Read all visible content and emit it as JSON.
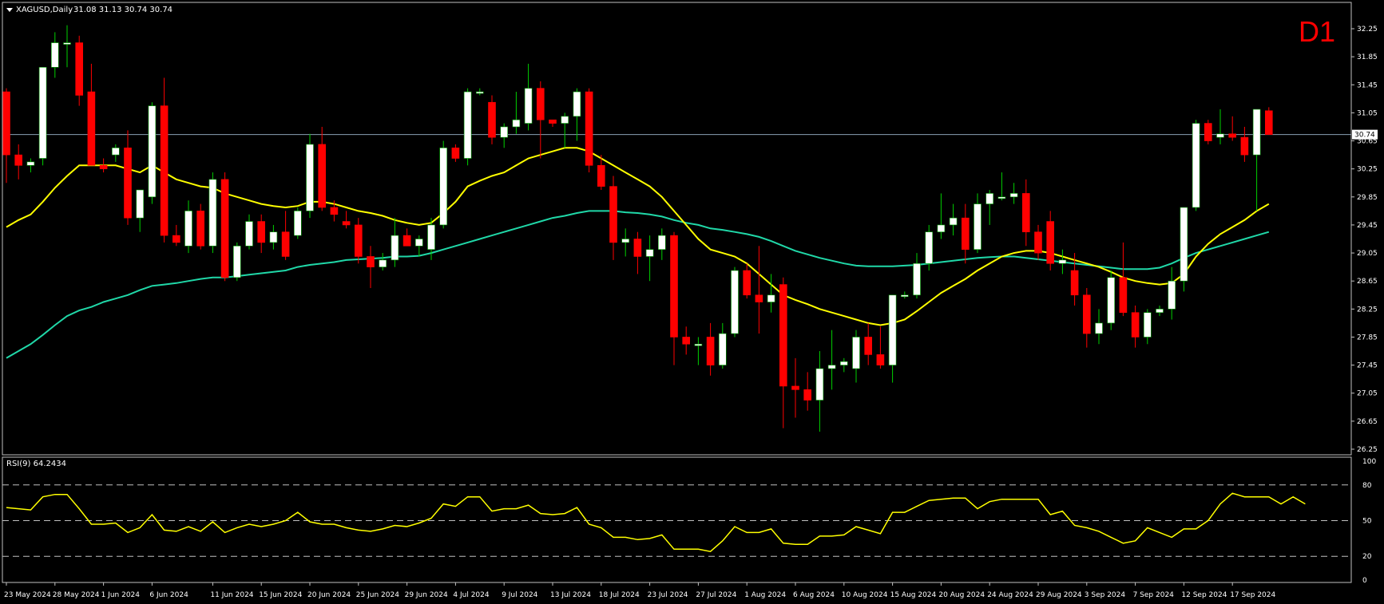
{
  "header": {
    "symbol_label": "XAGUSD,Daily",
    "ohlc_label": "31.08 31.13 30.74 30.74",
    "timeframe": "D1"
  },
  "rsi_panel": {
    "label": "RSI(9) 64.2434",
    "ticks": [
      "100",
      "80",
      "50",
      "20",
      "0"
    ]
  },
  "colors": {
    "background": "#000000",
    "bull_candle": "#ffffff",
    "bear_candle": "#ff0000",
    "ma_fast": "#ffff00",
    "ma_slow": "#20d8a8",
    "rsi_line": "#ffff00",
    "timeframe_text": "#ff0000",
    "grid_frame": "#c0c0c0"
  },
  "chart_data": [
    {
      "type": "candlestick",
      "symbol": "XAGUSD",
      "timeframe": "Daily",
      "ylim": [
        26.25,
        32.45
      ],
      "yticks": [
        "32.25",
        "31.85",
        "31.45",
        "31.05",
        "30.65",
        "30.25",
        "29.85",
        "29.45",
        "29.05",
        "28.65",
        "28.25",
        "27.85",
        "27.45",
        "27.05",
        "26.65",
        "26.25"
      ],
      "current_price": "30.74",
      "xticks": [
        {
          "label": "23 May 2024",
          "index": 0
        },
        {
          "label": "28 May 2024",
          "index": 4
        },
        {
          "label": "1 Jun 2024",
          "index": 8
        },
        {
          "label": "6 Jun 2024",
          "index": 12
        },
        {
          "label": "11 Jun 2024",
          "index": 17
        },
        {
          "label": "15 Jun 2024",
          "index": 21
        },
        {
          "label": "20 Jun 2024",
          "index": 25
        },
        {
          "label": "25 Jun 2024",
          "index": 29
        },
        {
          "label": "29 Jun 2024",
          "index": 33
        },
        {
          "label": "4 Jul 2024",
          "index": 37
        },
        {
          "label": "9 Jul 2024",
          "index": 41
        },
        {
          "label": "13 Jul 2024",
          "index": 45
        },
        {
          "label": "18 Jul 2024",
          "index": 49
        },
        {
          "label": "23 Jul 2024",
          "index": 53
        },
        {
          "label": "27 Jul 2024",
          "index": 57
        },
        {
          "label": "1 Aug 2024",
          "index": 61
        },
        {
          "label": "6 Aug 2024",
          "index": 65
        },
        {
          "label": "10 Aug 2024",
          "index": 69
        },
        {
          "label": "15 Aug 2024",
          "index": 73
        },
        {
          "label": "20 Aug 2024",
          "index": 77
        },
        {
          "label": "24 Aug 2024",
          "index": 81
        },
        {
          "label": "29 Aug 2024",
          "index": 85
        },
        {
          "label": "3 Sep 2024",
          "index": 89
        },
        {
          "label": "7 Sep 2024",
          "index": 93
        },
        {
          "label": "12 Sep 2024",
          "index": 97
        },
        {
          "label": "17 Sep 2024",
          "index": 101
        }
      ],
      "candles": [
        {
          "o": 31.35,
          "h": 31.4,
          "l": 30.05,
          "c": 30.45
        },
        {
          "o": 30.45,
          "h": 30.6,
          "l": 30.1,
          "c": 30.3
        },
        {
          "o": 30.3,
          "h": 30.4,
          "l": 30.2,
          "c": 30.35
        },
        {
          "o": 30.4,
          "h": 31.4,
          "l": 30.3,
          "c": 31.7
        },
        {
          "o": 31.7,
          "h": 32.2,
          "l": 31.55,
          "c": 32.05
        },
        {
          "o": 32.05,
          "h": 32.3,
          "l": 31.7,
          "c": 32.05
        },
        {
          "o": 32.05,
          "h": 32.15,
          "l": 31.15,
          "c": 31.3
        },
        {
          "o": 31.35,
          "h": 31.75,
          "l": 30.45,
          "c": 30.3
        },
        {
          "o": 30.3,
          "h": 30.4,
          "l": 30.2,
          "c": 30.25
        },
        {
          "o": 30.45,
          "h": 30.6,
          "l": 30.35,
          "c": 30.55
        },
        {
          "o": 30.55,
          "h": 30.8,
          "l": 29.45,
          "c": 29.55
        },
        {
          "o": 29.55,
          "h": 29.95,
          "l": 29.35,
          "c": 29.95
        },
        {
          "o": 29.85,
          "h": 31.2,
          "l": 29.75,
          "c": 31.15
        },
        {
          "o": 31.15,
          "h": 31.55,
          "l": 29.2,
          "c": 29.3
        },
        {
          "o": 29.3,
          "h": 29.45,
          "l": 29.15,
          "c": 29.2
        },
        {
          "o": 29.15,
          "h": 29.8,
          "l": 29.05,
          "c": 29.65
        },
        {
          "o": 29.65,
          "h": 29.75,
          "l": 29.1,
          "c": 29.15
        },
        {
          "o": 29.15,
          "h": 30.2,
          "l": 29.05,
          "c": 30.1
        },
        {
          "o": 30.1,
          "h": 30.2,
          "l": 28.65,
          "c": 28.7
        },
        {
          "o": 28.7,
          "h": 29.2,
          "l": 28.65,
          "c": 29.15
        },
        {
          "o": 29.15,
          "h": 29.6,
          "l": 29.1,
          "c": 29.5
        },
        {
          "o": 29.5,
          "h": 29.6,
          "l": 29.05,
          "c": 29.2
        },
        {
          "o": 29.2,
          "h": 29.45,
          "l": 29.1,
          "c": 29.35
        },
        {
          "o": 29.35,
          "h": 29.65,
          "l": 28.95,
          "c": 29.0
        },
        {
          "o": 29.3,
          "h": 29.7,
          "l": 29.25,
          "c": 29.65
        },
        {
          "o": 29.65,
          "h": 30.75,
          "l": 29.55,
          "c": 30.6
        },
        {
          "o": 30.6,
          "h": 30.85,
          "l": 29.65,
          "c": 29.7
        },
        {
          "o": 29.7,
          "h": 29.8,
          "l": 29.5,
          "c": 29.6
        },
        {
          "o": 29.5,
          "h": 29.65,
          "l": 29.4,
          "c": 29.45
        },
        {
          "o": 29.45,
          "h": 29.55,
          "l": 28.9,
          "c": 29.0
        },
        {
          "o": 29.0,
          "h": 29.15,
          "l": 28.55,
          "c": 28.85
        },
        {
          "o": 28.85,
          "h": 29.05,
          "l": 28.8,
          "c": 28.95
        },
        {
          "o": 28.95,
          "h": 29.55,
          "l": 28.85,
          "c": 29.3
        },
        {
          "o": 29.3,
          "h": 29.4,
          "l": 29.15,
          "c": 29.15
        },
        {
          "o": 29.15,
          "h": 29.3,
          "l": 29.0,
          "c": 29.25
        },
        {
          "o": 29.1,
          "h": 29.55,
          "l": 28.95,
          "c": 29.45
        },
        {
          "o": 29.45,
          "h": 30.65,
          "l": 29.4,
          "c": 30.55
        },
        {
          "o": 30.55,
          "h": 30.6,
          "l": 30.35,
          "c": 30.4
        },
        {
          "o": 30.4,
          "h": 31.4,
          "l": 30.3,
          "c": 31.35
        },
        {
          "o": 31.35,
          "h": 31.4,
          "l": 31.3,
          "c": 31.35
        },
        {
          "o": 31.2,
          "h": 31.3,
          "l": 30.6,
          "c": 30.7
        },
        {
          "o": 30.7,
          "h": 30.9,
          "l": 30.55,
          "c": 30.85
        },
        {
          "o": 30.85,
          "h": 31.35,
          "l": 30.75,
          "c": 30.95
        },
        {
          "o": 30.9,
          "h": 31.75,
          "l": 30.8,
          "c": 31.4
        },
        {
          "o": 31.4,
          "h": 31.5,
          "l": 30.4,
          "c": 30.95
        },
        {
          "o": 30.95,
          "h": 30.95,
          "l": 30.85,
          "c": 30.9
        },
        {
          "o": 30.9,
          "h": 31.05,
          "l": 30.55,
          "c": 31.0
        },
        {
          "o": 31.0,
          "h": 31.4,
          "l": 30.65,
          "c": 31.35
        },
        {
          "o": 31.35,
          "h": 31.4,
          "l": 30.2,
          "c": 30.3
        },
        {
          "o": 30.3,
          "h": 30.45,
          "l": 29.95,
          "c": 30.0
        },
        {
          "o": 30.0,
          "h": 30.15,
          "l": 28.95,
          "c": 29.2
        },
        {
          "o": 29.2,
          "h": 29.4,
          "l": 29.0,
          "c": 29.25
        },
        {
          "o": 29.25,
          "h": 29.35,
          "l": 28.75,
          "c": 29.0
        },
        {
          "o": 29.0,
          "h": 29.3,
          "l": 28.65,
          "c": 29.1
        },
        {
          "o": 29.1,
          "h": 29.4,
          "l": 28.95,
          "c": 29.3
        },
        {
          "o": 29.3,
          "h": 29.35,
          "l": 27.45,
          "c": 27.85
        },
        {
          "o": 27.85,
          "h": 28.0,
          "l": 27.6,
          "c": 27.75
        },
        {
          "o": 27.75,
          "h": 27.85,
          "l": 27.45,
          "c": 27.75
        },
        {
          "o": 27.85,
          "h": 28.05,
          "l": 27.3,
          "c": 27.45
        },
        {
          "o": 27.45,
          "h": 28.05,
          "l": 27.4,
          "c": 27.9
        },
        {
          "o": 27.9,
          "h": 28.85,
          "l": 27.85,
          "c": 28.8
        },
        {
          "o": 28.8,
          "h": 28.9,
          "l": 28.4,
          "c": 28.45
        },
        {
          "o": 28.45,
          "h": 29.15,
          "l": 27.9,
          "c": 28.35
        },
        {
          "o": 28.35,
          "h": 28.75,
          "l": 28.2,
          "c": 28.45
        },
        {
          "o": 28.6,
          "h": 28.7,
          "l": 26.55,
          "c": 27.15
        },
        {
          "o": 27.15,
          "h": 27.55,
          "l": 26.7,
          "c": 27.1
        },
        {
          "o": 27.1,
          "h": 27.35,
          "l": 26.8,
          "c": 26.95
        },
        {
          "o": 26.95,
          "h": 27.65,
          "l": 26.5,
          "c": 27.4
        },
        {
          "o": 27.4,
          "h": 27.95,
          "l": 27.1,
          "c": 27.45
        },
        {
          "o": 27.45,
          "h": 27.55,
          "l": 27.35,
          "c": 27.5
        },
        {
          "o": 27.4,
          "h": 27.95,
          "l": 27.2,
          "c": 27.85
        },
        {
          "o": 27.85,
          "h": 28.05,
          "l": 27.45,
          "c": 27.6
        },
        {
          "o": 27.6,
          "h": 28.0,
          "l": 27.4,
          "c": 27.45
        },
        {
          "o": 27.45,
          "h": 28.45,
          "l": 27.2,
          "c": 28.45
        },
        {
          "o": 28.45,
          "h": 28.5,
          "l": 28.4,
          "c": 28.45
        },
        {
          "o": 28.45,
          "h": 29.05,
          "l": 28.4,
          "c": 28.9
        },
        {
          "o": 28.9,
          "h": 29.45,
          "l": 28.8,
          "c": 29.35
        },
        {
          "o": 29.35,
          "h": 29.9,
          "l": 29.25,
          "c": 29.45
        },
        {
          "o": 29.45,
          "h": 29.75,
          "l": 29.3,
          "c": 29.55
        },
        {
          "o": 29.55,
          "h": 29.75,
          "l": 28.9,
          "c": 29.1
        },
        {
          "o": 29.1,
          "h": 29.9,
          "l": 29.05,
          "c": 29.75
        },
        {
          "o": 29.75,
          "h": 29.95,
          "l": 29.45,
          "c": 29.9
        },
        {
          "o": 29.85,
          "h": 30.2,
          "l": 29.8,
          "c": 29.85
        },
        {
          "o": 29.85,
          "h": 30.05,
          "l": 29.75,
          "c": 29.9
        },
        {
          "o": 29.9,
          "h": 30.1,
          "l": 29.15,
          "c": 29.35
        },
        {
          "o": 29.35,
          "h": 29.45,
          "l": 28.95,
          "c": 29.05
        },
        {
          "o": 29.5,
          "h": 29.65,
          "l": 28.8,
          "c": 28.9
        },
        {
          "o": 28.9,
          "h": 29.1,
          "l": 28.75,
          "c": 28.95
        },
        {
          "o": 28.8,
          "h": 29.05,
          "l": 28.3,
          "c": 28.45
        },
        {
          "o": 28.45,
          "h": 28.55,
          "l": 27.7,
          "c": 27.9
        },
        {
          "o": 27.9,
          "h": 28.25,
          "l": 27.75,
          "c": 28.05
        },
        {
          "o": 28.05,
          "h": 28.8,
          "l": 27.95,
          "c": 28.7
        },
        {
          "o": 28.7,
          "h": 29.2,
          "l": 28.15,
          "c": 28.2
        },
        {
          "o": 28.2,
          "h": 28.3,
          "l": 27.7,
          "c": 27.85
        },
        {
          "o": 27.85,
          "h": 28.25,
          "l": 27.75,
          "c": 28.2
        },
        {
          "o": 28.2,
          "h": 28.3,
          "l": 28.15,
          "c": 28.25
        },
        {
          "o": 28.25,
          "h": 28.85,
          "l": 28.1,
          "c": 28.65
        },
        {
          "o": 28.65,
          "h": 29.7,
          "l": 28.5,
          "c": 29.7
        },
        {
          "o": 29.7,
          "h": 30.95,
          "l": 29.65,
          "c": 30.9
        },
        {
          "o": 30.9,
          "h": 30.95,
          "l": 30.6,
          "c": 30.65
        },
        {
          "o": 30.7,
          "h": 31.1,
          "l": 30.6,
          "c": 30.75
        },
        {
          "o": 30.75,
          "h": 31.0,
          "l": 30.65,
          "c": 30.7
        },
        {
          "o": 30.7,
          "h": 30.85,
          "l": 30.35,
          "c": 30.45
        },
        {
          "o": 30.45,
          "h": 30.95,
          "l": 29.65,
          "c": 31.1
        },
        {
          "o": 31.08,
          "h": 31.13,
          "l": 30.74,
          "c": 30.74
        }
      ],
      "ma_fast": [
        29.42,
        29.52,
        29.6,
        29.78,
        29.98,
        30.15,
        30.3,
        30.3,
        30.3,
        30.3,
        30.25,
        30.2,
        30.3,
        30.2,
        30.1,
        30.05,
        30.0,
        29.98,
        29.9,
        29.85,
        29.8,
        29.75,
        29.72,
        29.7,
        29.72,
        29.78,
        29.78,
        29.75,
        29.7,
        29.65,
        29.62,
        29.58,
        29.52,
        29.48,
        29.45,
        29.48,
        29.62,
        29.78,
        30.0,
        30.08,
        30.15,
        30.2,
        30.3,
        30.4,
        30.45,
        30.5,
        30.55,
        30.55,
        30.5,
        30.4,
        30.3,
        30.2,
        30.1,
        30.0,
        29.85,
        29.65,
        29.45,
        29.25,
        29.1,
        29.05,
        29.0,
        28.9,
        28.75,
        28.6,
        28.45,
        28.38,
        28.32,
        28.25,
        28.2,
        28.15,
        28.1,
        28.05,
        28.02,
        28.05,
        28.1,
        28.22,
        28.35,
        28.48,
        28.58,
        28.68,
        28.8,
        28.9,
        29.0,
        29.05,
        29.08,
        29.08,
        29.05,
        29.0,
        28.95,
        28.9,
        28.85,
        28.78,
        28.7,
        28.65,
        28.62,
        28.6,
        28.62,
        28.75,
        29.0,
        29.18,
        29.32,
        29.42,
        29.52,
        29.65,
        29.75
      ],
      "ma_slow": [
        27.55,
        27.65,
        27.75,
        27.88,
        28.02,
        28.15,
        28.23,
        28.28,
        28.35,
        28.4,
        28.45,
        28.52,
        28.58,
        28.6,
        28.62,
        28.65,
        28.68,
        28.7,
        28.7,
        28.72,
        28.74,
        28.76,
        28.78,
        28.8,
        28.85,
        28.88,
        28.9,
        28.92,
        28.95,
        28.96,
        28.97,
        28.98,
        29.0,
        29.0,
        29.01,
        29.05,
        29.1,
        29.15,
        29.2,
        29.25,
        29.3,
        29.35,
        29.4,
        29.45,
        29.5,
        29.55,
        29.58,
        29.62,
        29.65,
        29.65,
        29.65,
        29.63,
        29.62,
        29.6,
        29.57,
        29.52,
        29.48,
        29.45,
        29.4,
        29.38,
        29.35,
        29.32,
        29.28,
        29.22,
        29.15,
        29.08,
        29.03,
        28.98,
        28.94,
        28.9,
        28.87,
        28.86,
        28.86,
        28.86,
        28.87,
        28.88,
        28.9,
        28.92,
        28.94,
        28.96,
        28.98,
        28.99,
        29.0,
        29.0,
        28.98,
        28.96,
        28.94,
        28.92,
        28.9,
        28.88,
        28.86,
        28.84,
        28.82,
        28.82,
        28.82,
        28.84,
        28.9,
        28.98,
        29.05,
        29.1,
        29.15,
        29.2,
        29.25,
        29.3,
        29.35
      ]
    },
    {
      "type": "line",
      "name": "RSI(9)",
      "ylim": [
        0,
        100
      ],
      "yticks": [
        100,
        80,
        50,
        20,
        0
      ],
      "levels": [
        80,
        50,
        20
      ],
      "values": [
        61,
        60,
        59,
        70,
        72,
        72,
        60,
        47,
        47,
        48,
        40,
        44,
        55,
        42,
        41,
        45,
        41,
        49,
        40,
        44,
        47,
        45,
        47,
        50,
        57,
        49,
        47,
        47,
        44,
        42,
        41,
        43,
        46,
        45,
        48,
        52,
        64,
        62,
        70,
        70,
        58,
        60,
        60,
        63,
        56,
        55,
        56,
        61,
        47,
        44,
        36,
        36,
        34,
        35,
        38,
        26,
        26,
        26,
        24,
        33,
        45,
        40,
        40,
        43,
        31,
        30,
        30,
        37,
        37,
        38,
        45,
        42,
        39,
        57,
        57,
        62,
        67,
        68,
        69,
        69,
        60,
        66,
        68,
        68,
        68,
        68,
        55,
        58,
        46,
        44,
        41,
        36,
        31,
        33,
        44,
        40,
        36,
        43,
        43,
        50,
        64,
        73,
        70,
        70,
        70,
        64,
        70,
        64
      ]
    }
  ]
}
